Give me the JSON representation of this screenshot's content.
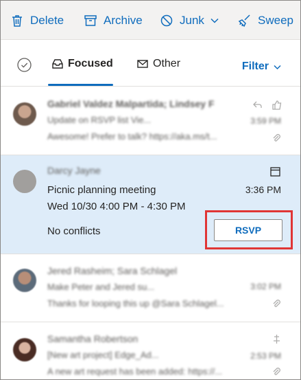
{
  "toolbar": {
    "delete_label": "Delete",
    "archive_label": "Archive",
    "junk_label": "Junk",
    "sweep_label": "Sweep"
  },
  "tabs": {
    "focused_label": "Focused",
    "other_label": "Other",
    "filter_label": "Filter"
  },
  "messages": [
    {
      "sender": "Gabriel Valdez Malpartida; Lindsey F",
      "subject": "Update on RSVP list Vie...",
      "preview": "Awesome! Prefer to talk? https://aka.ms/t...",
      "time": "3:59 PM"
    },
    {
      "sender": "Darcy Jayne",
      "subject": "Picnic planning meeting",
      "when": "Wed 10/30 4:00 PM - 4:30 PM",
      "conflicts": "No conflicts",
      "time": "3:36 PM",
      "rsvp_label": "RSVP"
    },
    {
      "sender": "Jered Rasheim; Sara Schlagel",
      "subject": "Make Peter and Jered su...",
      "preview": "Thanks for looping this up @Sara Schlagel...",
      "time": "3:02 PM"
    },
    {
      "sender": "Samantha Robertson",
      "subject": "[New art project] Edge_Ad...",
      "preview": "A new art request has been added: https://...",
      "time": "2:53 PM"
    }
  ],
  "colors": {
    "accent": "#0f6cbd",
    "selected_bg": "#deecf9",
    "highlight_border": "#e03535",
    "toolbar_bg": "#f3f2f1"
  }
}
